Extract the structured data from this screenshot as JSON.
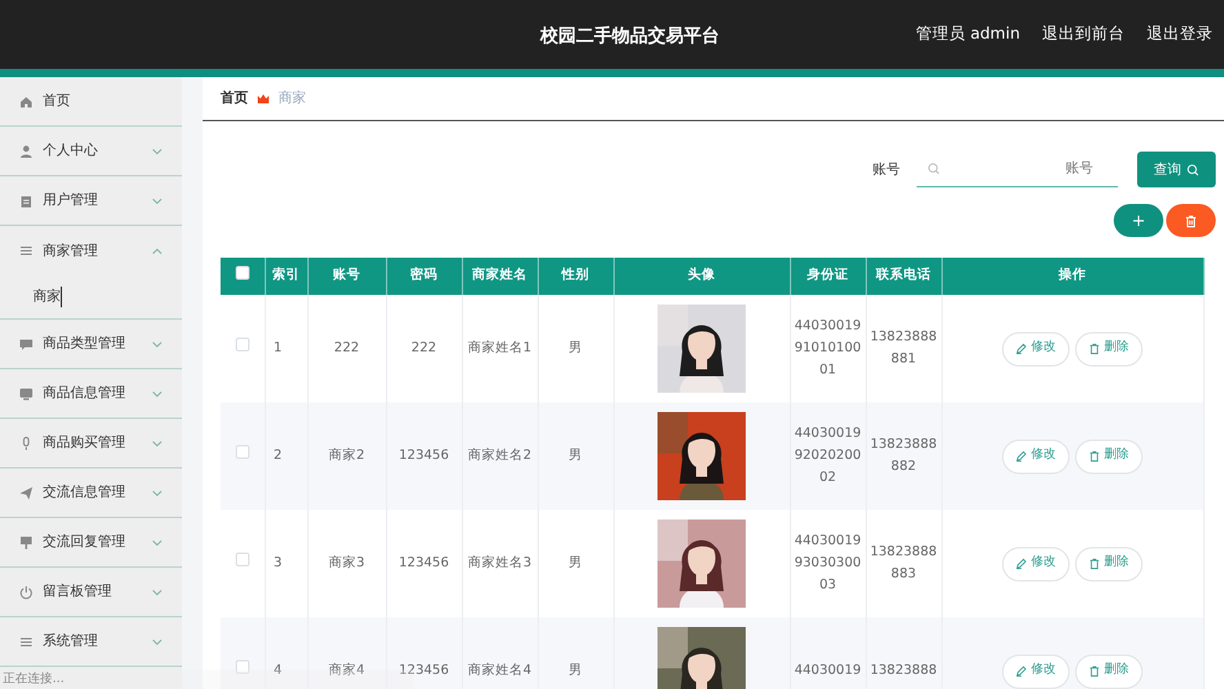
{
  "header": {
    "title": "校园二手物品交易平台",
    "links": [
      "管理员 admin",
      "退出到前台",
      "退出登录"
    ]
  },
  "sidebar": {
    "items": [
      {
        "label": "首页"
      },
      {
        "label": "个人中心",
        "expanded": false
      },
      {
        "label": "用户管理",
        "expanded": false
      },
      {
        "label": "商家管理",
        "expanded": true,
        "children": [
          {
            "label": "商家"
          }
        ]
      },
      {
        "label": "商品类型管理",
        "expanded": false
      },
      {
        "label": "商品信息管理",
        "expanded": false
      },
      {
        "label": "商品购买管理",
        "expanded": false
      },
      {
        "label": "交流信息管理",
        "expanded": false
      },
      {
        "label": "交流回复管理",
        "expanded": false
      },
      {
        "label": "留言板管理",
        "expanded": false
      },
      {
        "label": "系统管理",
        "expanded": false
      }
    ]
  },
  "breadcrumb": [
    "首页",
    "商家"
  ],
  "search": {
    "label": "账号",
    "placeholder": "账号",
    "button": "查询"
  },
  "add_button": "+",
  "table": {
    "select_all": {
      "checked": false
    },
    "columns": [
      "索引",
      "账号",
      "密码",
      "商家姓名",
      "性别",
      "头像",
      "身份证",
      "联系电话",
      "操作"
    ],
    "rows": [
      {
        "selected": false,
        "cells": [
          "1",
          "222",
          "222",
          "商家姓名1",
          "男",
          {
            "kind": "picture"
          },
          "440300199101010001",
          "13823888881"
        ],
        "actions": [
          "修改",
          "删除"
        ]
      },
      {
        "selected": false,
        "cells": [
          "2",
          "商家2",
          "123456",
          "商家姓名2",
          "男",
          {
            "kind": "picture"
          },
          "440300199202020002",
          "13823888882"
        ],
        "actions": [
          "修改",
          "删除"
        ]
      },
      {
        "selected": false,
        "cells": [
          "3",
          "商家3",
          "123456",
          "商家姓名3",
          "男",
          {
            "kind": "picture"
          },
          "440300199303030003",
          "13823888883"
        ],
        "actions": [
          "修改",
          "删除"
        ]
      },
      {
        "selected": false,
        "cells": [
          "4",
          "商家4",
          "123456",
          "商家姓名4",
          "男",
          {
            "kind": "picture"
          },
          "44030019",
          "13823888"
        ],
        "actions": [
          "修改",
          "删除"
        ]
      }
    ]
  },
  "status_bar": "正在连接..."
}
